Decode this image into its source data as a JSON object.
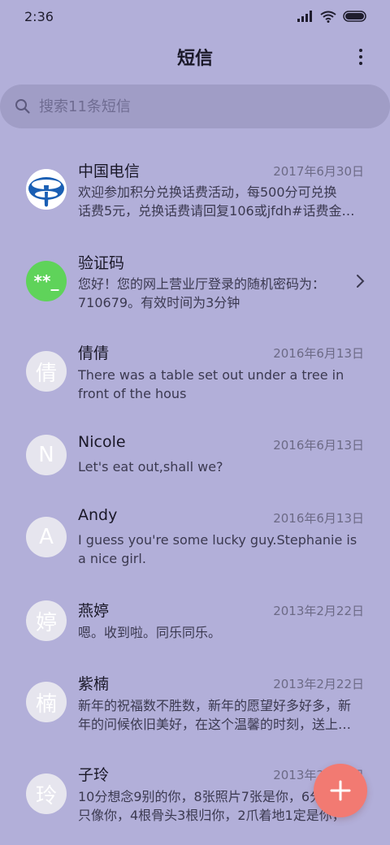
{
  "status_bar": {
    "time": "2:36",
    "icons": [
      "signal-icon",
      "wifi-icon",
      "battery-icon"
    ]
  },
  "header": {
    "title": "短信",
    "more_icon": "more-vertical-icon"
  },
  "search": {
    "placeholder": "搜索11条短信",
    "icon": "search-icon"
  },
  "messages": [
    {
      "name": "中国电信",
      "date": "2017年6月30日",
      "avatar": "china-telecom-logo",
      "preview_line1": "欢迎参加积分兑换话费活动，每500分可兑换",
      "preview_line2": "话费5元，兑换话费请回复106或jfdh#话费金…"
    },
    {
      "name": "验证码",
      "date": "",
      "avatar_text": "**_",
      "preview_line1": "您好！您的网上营业厅登录的随机密码为：",
      "preview_line2": "710679。有效时间为3分钟"
    },
    {
      "name": "倩倩",
      "date": "2016年6月13日",
      "avatar_text": "倩",
      "preview_line1": "There was a table set out under a tree in",
      "preview_line2": "front of the hous"
    },
    {
      "name": "Nicole",
      "date": "2016年6月13日",
      "avatar_text": "N",
      "preview_line1": "Let's eat out,shall we?",
      "preview_line2": ""
    },
    {
      "name": "Andy",
      "date": "2016年6月13日",
      "avatar_text": "A",
      "preview_line1": "I guess you're some lucky guy.Stephanie is",
      "preview_line2": "a nice girl."
    },
    {
      "name": "燕婷",
      "date": "2013年2月22日",
      "avatar_text": "婷",
      "preview_line1": "嗯。收到啦。同乐同乐。",
      "preview_line2": ""
    },
    {
      "name": "紫楠",
      "date": "2013年2月22日",
      "avatar_text": "楠",
      "preview_line1": "新年的祝福数不胜数，新年的愿望好多好多，新",
      "preview_line2": "年的问候依旧美好，在这个温馨的时刻，送上…"
    },
    {
      "name": "子玲",
      "date": "2013年2月22日",
      "avatar_text": "玲",
      "preview_line1": "10分想念9别的你，8张照片7张是你，6分",
      "preview_line2": "只像你，4根骨头3根归你，2爪着地1定是你，"
    }
  ],
  "fab": {
    "icon": "plus-icon"
  },
  "colors": {
    "background": "#b2afd9",
    "fab": "#f27a72",
    "verification_avatar": "#5fd35a",
    "telecom_blue": "#1a5fb4"
  }
}
